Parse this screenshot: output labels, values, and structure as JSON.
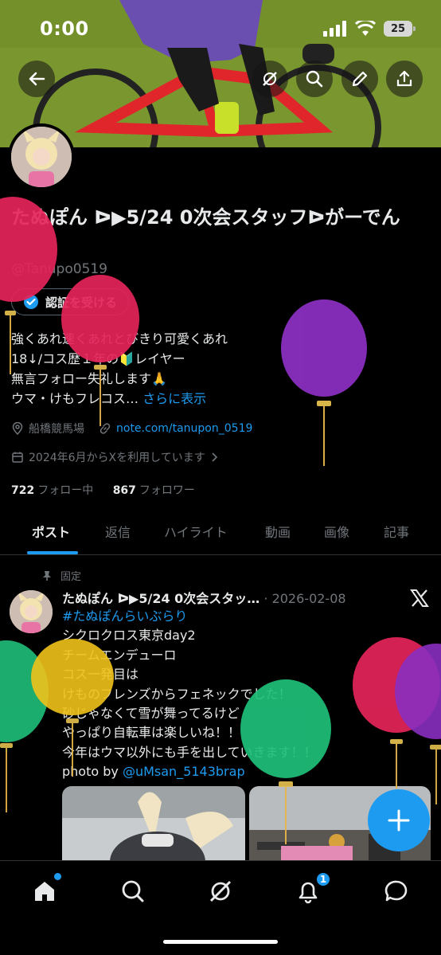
{
  "status_bar": {
    "time": "0:00",
    "battery": "25"
  },
  "profile": {
    "name": "たぬぽん ᐅ▶5/24 0次会スタッフᐅがーでん",
    "handle": "@Tanupo0519",
    "verify_label": "認証を受ける",
    "bio_lines": [
      "強くあれ速くあれとびきり可愛くあれ",
      "18↓/コス歴１年の🔰レイヤー",
      "無言フォロー失礼します🙏",
      "ウマ・けもフレコス… "
    ],
    "bio_more": "さらに表示",
    "location": "船橋競馬場",
    "website": "note.com/tanupon_0519",
    "joined": "2024年6月からXを利用しています",
    "following_count": "722",
    "following_label": "フォロー中",
    "followers_count": "867",
    "followers_label": "フォロワー"
  },
  "tabs": [
    "ポスト",
    "返信",
    "ハイライト",
    "動画",
    "画像",
    "記事"
  ],
  "post": {
    "pinned_label": "固定",
    "author": "たぬぽん ᐅ▶5/24 0次会スタッ…",
    "date": " · 2026-02-08",
    "hashtag": "#たぬぽんらいぶらり",
    "lines": [
      "シクロクロス東京day2",
      "チームエンデューロ",
      "コス一発目は",
      "けものフレンズからフェネックでした！",
      "砂じゃなくて雪が舞ってるけど",
      "やっぱり自転車は楽しいね！！",
      "今年はウマ以外にも手を出していきます！！"
    ],
    "photo_prefix": "photo by ",
    "photo_credit": "@uMsan_5143brap"
  },
  "nav": {
    "notification_count": "1"
  },
  "colors": {
    "accent": "#1d9bf0",
    "background": "#000000",
    "text": "#e7e9ea",
    "muted": "#71767b"
  }
}
